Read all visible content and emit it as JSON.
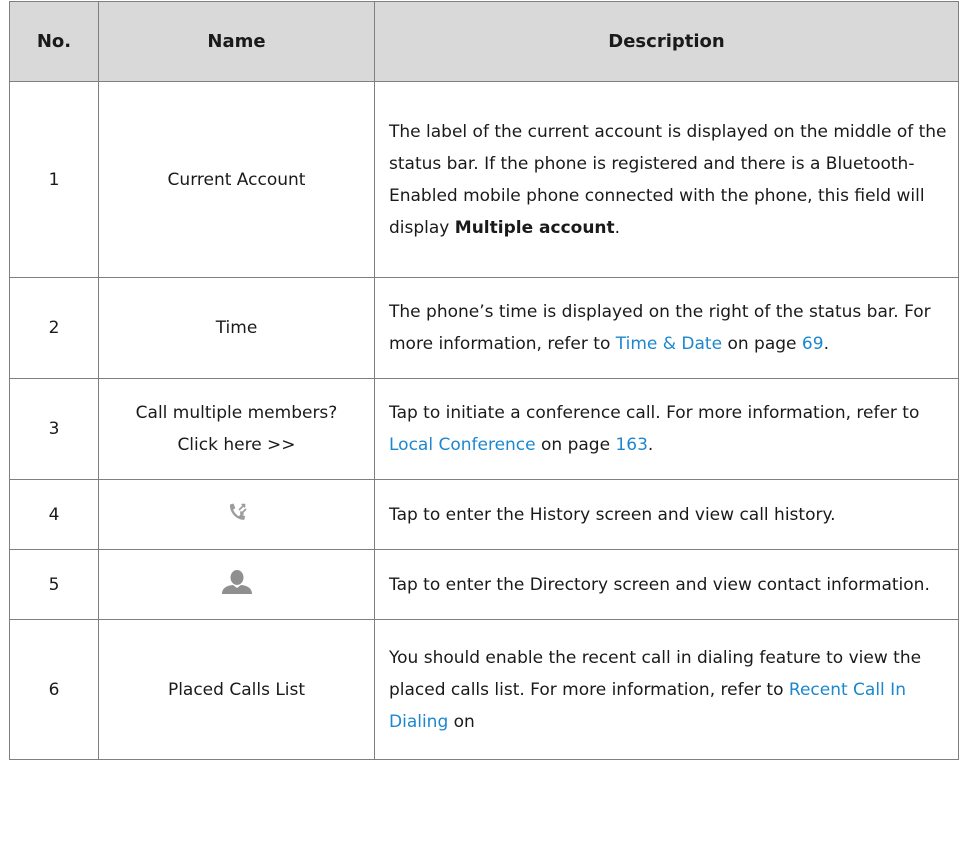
{
  "headers": {
    "no": "No.",
    "name": "Name",
    "description": "Description"
  },
  "rows": [
    {
      "no": "1",
      "name": "Current Account",
      "desc": {
        "t1": "The label of the current account is displayed on the middle of the status bar. If the phone is registered and there is a Bluetooth-Enabled mobile phone connected with the phone, this field will display ",
        "bold": "Multiple account",
        "t2": "."
      }
    },
    {
      "no": "2",
      "name": "Time",
      "desc": {
        "t1": "The phone’s time is displayed on the right of the status bar. For more information, refer to ",
        "link": "Time & Date",
        "t2": " on page ",
        "page": "69",
        "t3": "."
      }
    },
    {
      "no": "3",
      "name_line1": "Call multiple members?",
      "name_line2": "Click here >>",
      "desc": {
        "t1": "Tap to initiate a conference call. For more information, refer to ",
        "link": "Local Conference",
        "t2": " on page ",
        "page": "163",
        "t3": "."
      }
    },
    {
      "no": "4",
      "icon": "call-history-icon",
      "desc": {
        "t1": "Tap to enter the History screen and view call history."
      }
    },
    {
      "no": "5",
      "icon": "contact-person-icon",
      "desc": {
        "t1": "Tap to enter the Directory screen and view contact information."
      }
    },
    {
      "no": "6",
      "name": "Placed Calls List",
      "desc": {
        "t1": "You should enable the recent call in dialing feature to view the placed calls list. For more information, refer to ",
        "link": "Recent Call In Dialing",
        "t2": " on"
      }
    }
  ],
  "colors": {
    "header_bg": "#d9d9d9",
    "link": "#1c87cf",
    "border": "#7f7f7f",
    "icon": "#999999"
  }
}
